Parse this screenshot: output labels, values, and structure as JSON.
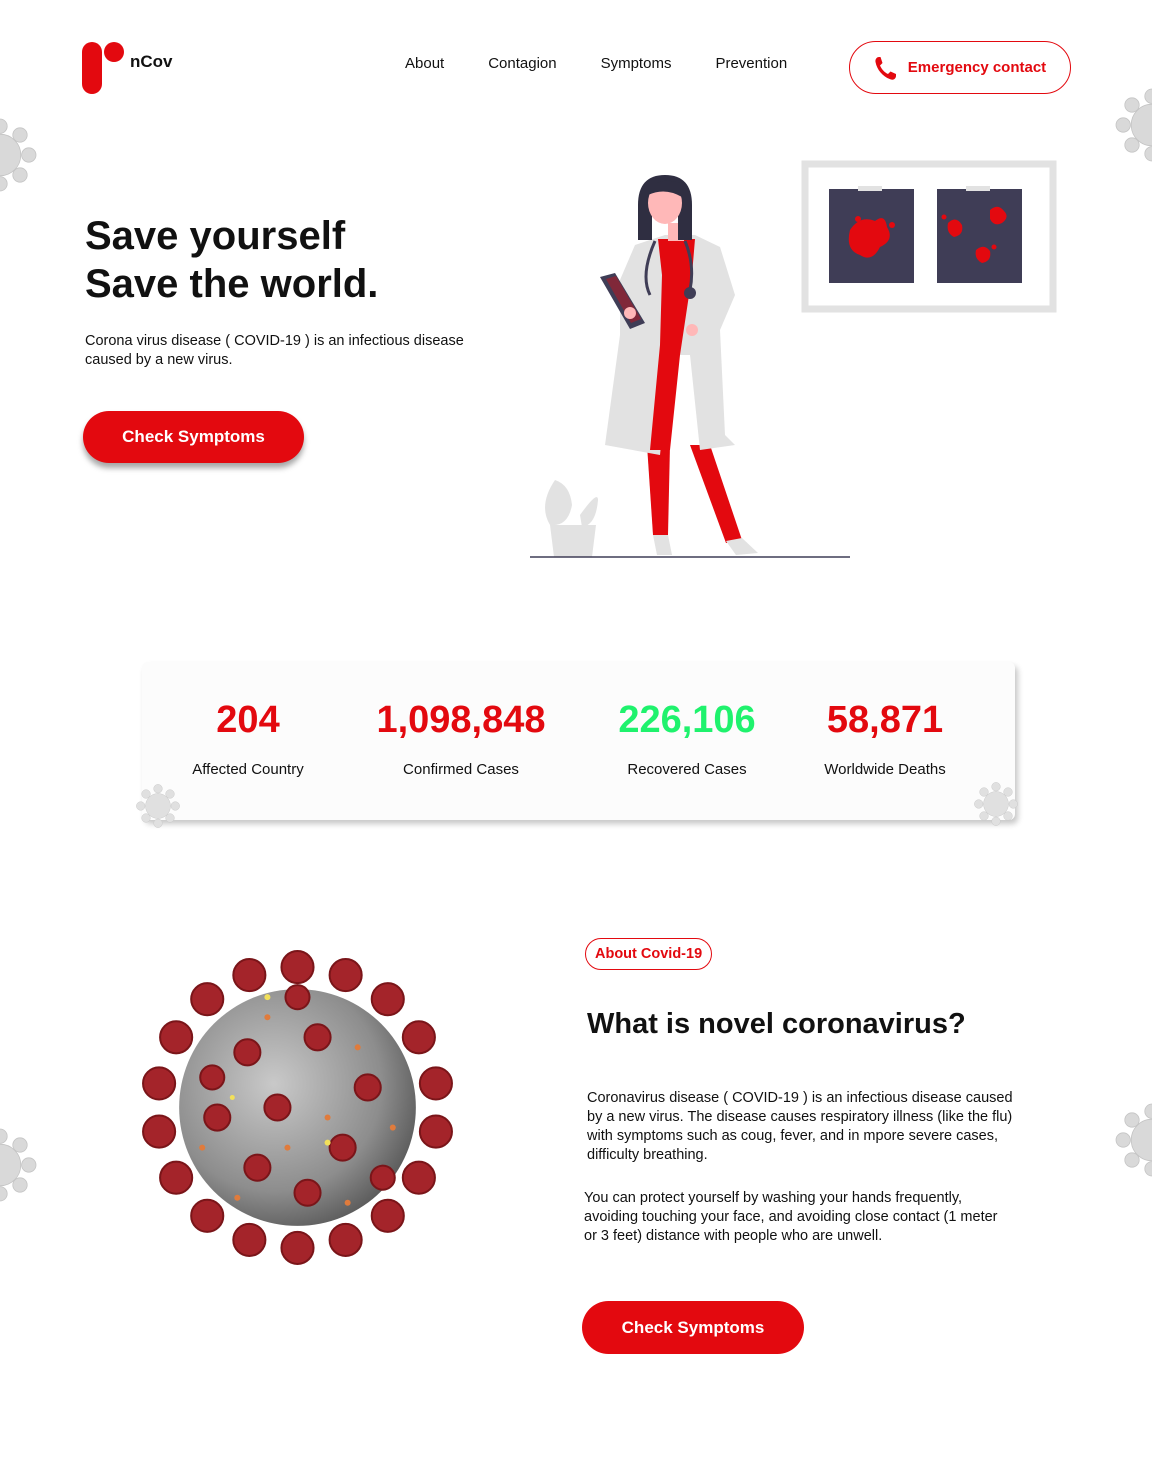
{
  "brand": {
    "name": "nCov",
    "color": "#e3090f"
  },
  "nav": {
    "items": [
      {
        "label": "About"
      },
      {
        "label": "Contagion"
      },
      {
        "label": "Symptoms"
      },
      {
        "label": "Prevention"
      }
    ],
    "emergency_label": "Emergency contact",
    "emergency_icon": "phone-icon"
  },
  "hero": {
    "title_line1": "Save yourself",
    "title_line2": "Save the world.",
    "description": "Corona virus  disease ( COVID-19 ) is an infectious disease caused by a new virus.",
    "button_label": "Check  Symptoms"
  },
  "stats": [
    {
      "value": "204",
      "label": "Affected Country",
      "color": "#e3090f"
    },
    {
      "value": "1,098,848",
      "label": "Confirmed Cases",
      "color": "#e3090f"
    },
    {
      "value": "226,106",
      "label": "Recovered Cases",
      "color": "#1ff26d"
    },
    {
      "value": "58,871",
      "label": "Worldwide Deaths",
      "color": "#e3090f"
    }
  ],
  "about": {
    "badge": "About Covid-19",
    "title": "What is novel coronavirus?",
    "paragraph1": "Coronavirus disease ( COVID-19 ) is an infectious  disease caused by a new virus. The disease causes respiratory illness (like the flu) with symptoms such as coug, fever, and in mpore severe cases, difficulty breathing.",
    "paragraph2": "You can protect yourself by washing your hands  frequently, avoiding touching your face, and avoiding close contact (1 meter  or 3  feet)  distance with people who are unwell.",
    "button_label": "Check Symptoms"
  }
}
